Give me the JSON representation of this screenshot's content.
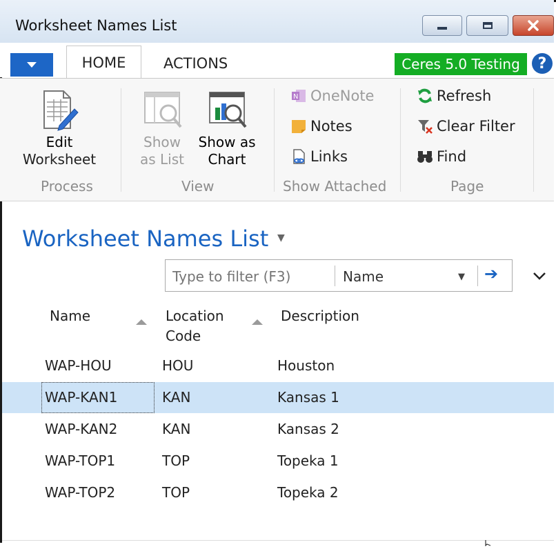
{
  "window": {
    "title": "Worksheet Names List"
  },
  "ribbon": {
    "tabs": [
      {
        "label": "HOME"
      },
      {
        "label": "ACTIONS"
      }
    ],
    "company": "Ceres 5.0 Testing",
    "help": "?",
    "groups": {
      "process": {
        "name": "Process",
        "edit_worksheet": [
          "Edit",
          "Worksheet"
        ]
      },
      "view": {
        "name": "View",
        "show_as_list": [
          "Show",
          "as List"
        ],
        "show_as_chart": [
          "Show as",
          "Chart"
        ]
      },
      "attached": {
        "name": "Show Attached",
        "onenote": "OneNote",
        "notes": "Notes",
        "links": "Links"
      },
      "page": {
        "name": "Page",
        "refresh": "Refresh",
        "clear_filter": "Clear Filter",
        "find": "Find"
      }
    }
  },
  "page": {
    "title": "Worksheet Names List",
    "filter": {
      "placeholder": "Type to filter (F3)",
      "field": "Name"
    }
  },
  "table": {
    "columns": {
      "name": "Name",
      "location_code": [
        "Location",
        "Code"
      ],
      "description": "Description"
    },
    "rows": [
      {
        "name": "WAP-HOU",
        "location": "HOU",
        "description": "Houston"
      },
      {
        "name": "WAP-KAN1",
        "location": "KAN",
        "description": "Kansas 1"
      },
      {
        "name": "WAP-KAN2",
        "location": "KAN",
        "description": "Kansas 2"
      },
      {
        "name": "WAP-TOP1",
        "location": "TOP",
        "description": "Topeka 1"
      },
      {
        "name": "WAP-TOP2",
        "location": "TOP",
        "description": "Topeka 2"
      }
    ],
    "selected_row": 1
  },
  "colors": {
    "accent": "#1a64c2",
    "company_badge": "#14ad24",
    "selection": "#cde3f7"
  }
}
